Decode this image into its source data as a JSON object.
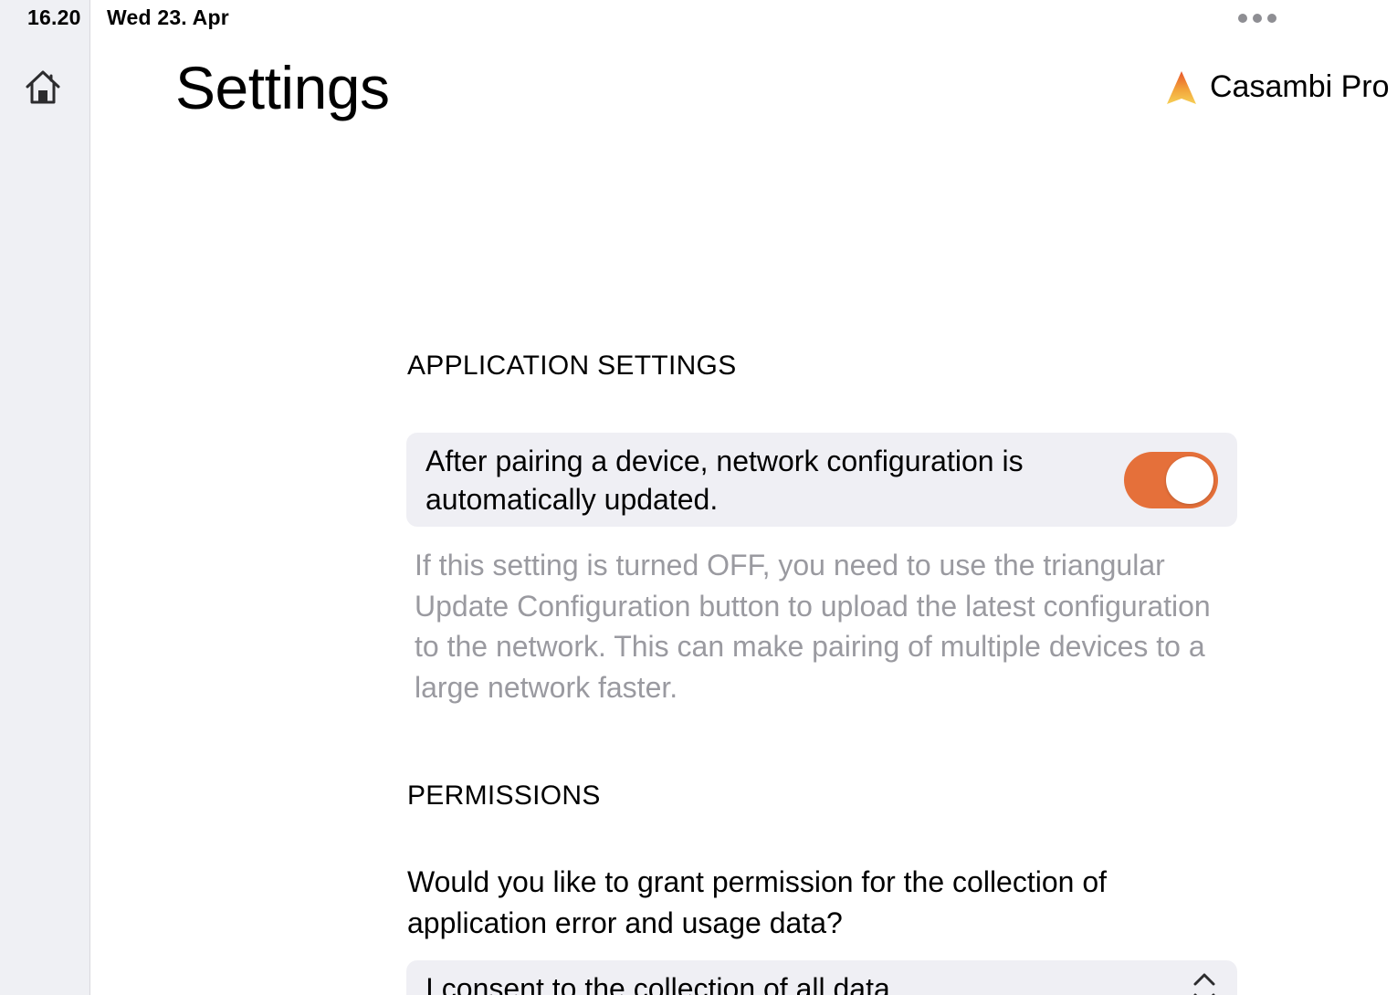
{
  "status_bar": {
    "time": "16.20",
    "date": "Wed 23. Apr",
    "multitask_icon": "ellipsis-icon"
  },
  "sidebar": {
    "home_icon": "home-icon"
  },
  "header": {
    "title": "Settings",
    "brand_name": "Casambi Pro",
    "brand_logo_icon": "casambi-logo-icon"
  },
  "application_settings": {
    "section_title": "APPLICATION SETTINGS",
    "auto_update": {
      "label": "After pairing a device, network configuration is automatically updated.",
      "enabled": true
    },
    "help_text": "If this setting is turned OFF, you need to use the triangular Update Configuration button to upload the latest configuration to the network. This can make pairing of multiple devices to a large network faster."
  },
  "permissions": {
    "section_title": "PERMISSIONS",
    "question": "Would you like to grant permission for the collection of application error and usage data?",
    "consent_select": {
      "selected": "I consent to the collection of all data.",
      "icon": "chevron-up-down-icon"
    }
  },
  "colors": {
    "accent": "#e5703a",
    "sidebar_bg": "#eff0f4",
    "card_bg": "#efeff4",
    "secondary_text": "#9a9aa0"
  }
}
